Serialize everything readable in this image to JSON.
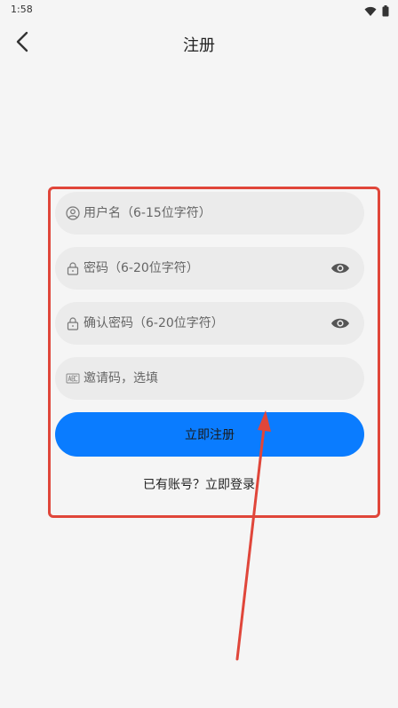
{
  "status": {
    "time": "1:58"
  },
  "header": {
    "title": "注册"
  },
  "form": {
    "username_placeholder": "用户名（6-15位字符）",
    "password_placeholder": "密码（6-20位字符）",
    "confirm_placeholder": "确认密码（6-20位字符）",
    "invite_placeholder": "邀请码，选填",
    "submit_label": "立即注册",
    "login_link": "已有账号？立即登录"
  },
  "colors": {
    "primary": "#0a7cff",
    "background": "#f5f5f5",
    "field_bg": "#ebebeb",
    "annotation": "#e0463a"
  },
  "icons": [
    "back-arrow-icon",
    "user-icon",
    "lock-icon",
    "eye-icon",
    "abc-icon",
    "wifi-icon",
    "battery-icon"
  ]
}
